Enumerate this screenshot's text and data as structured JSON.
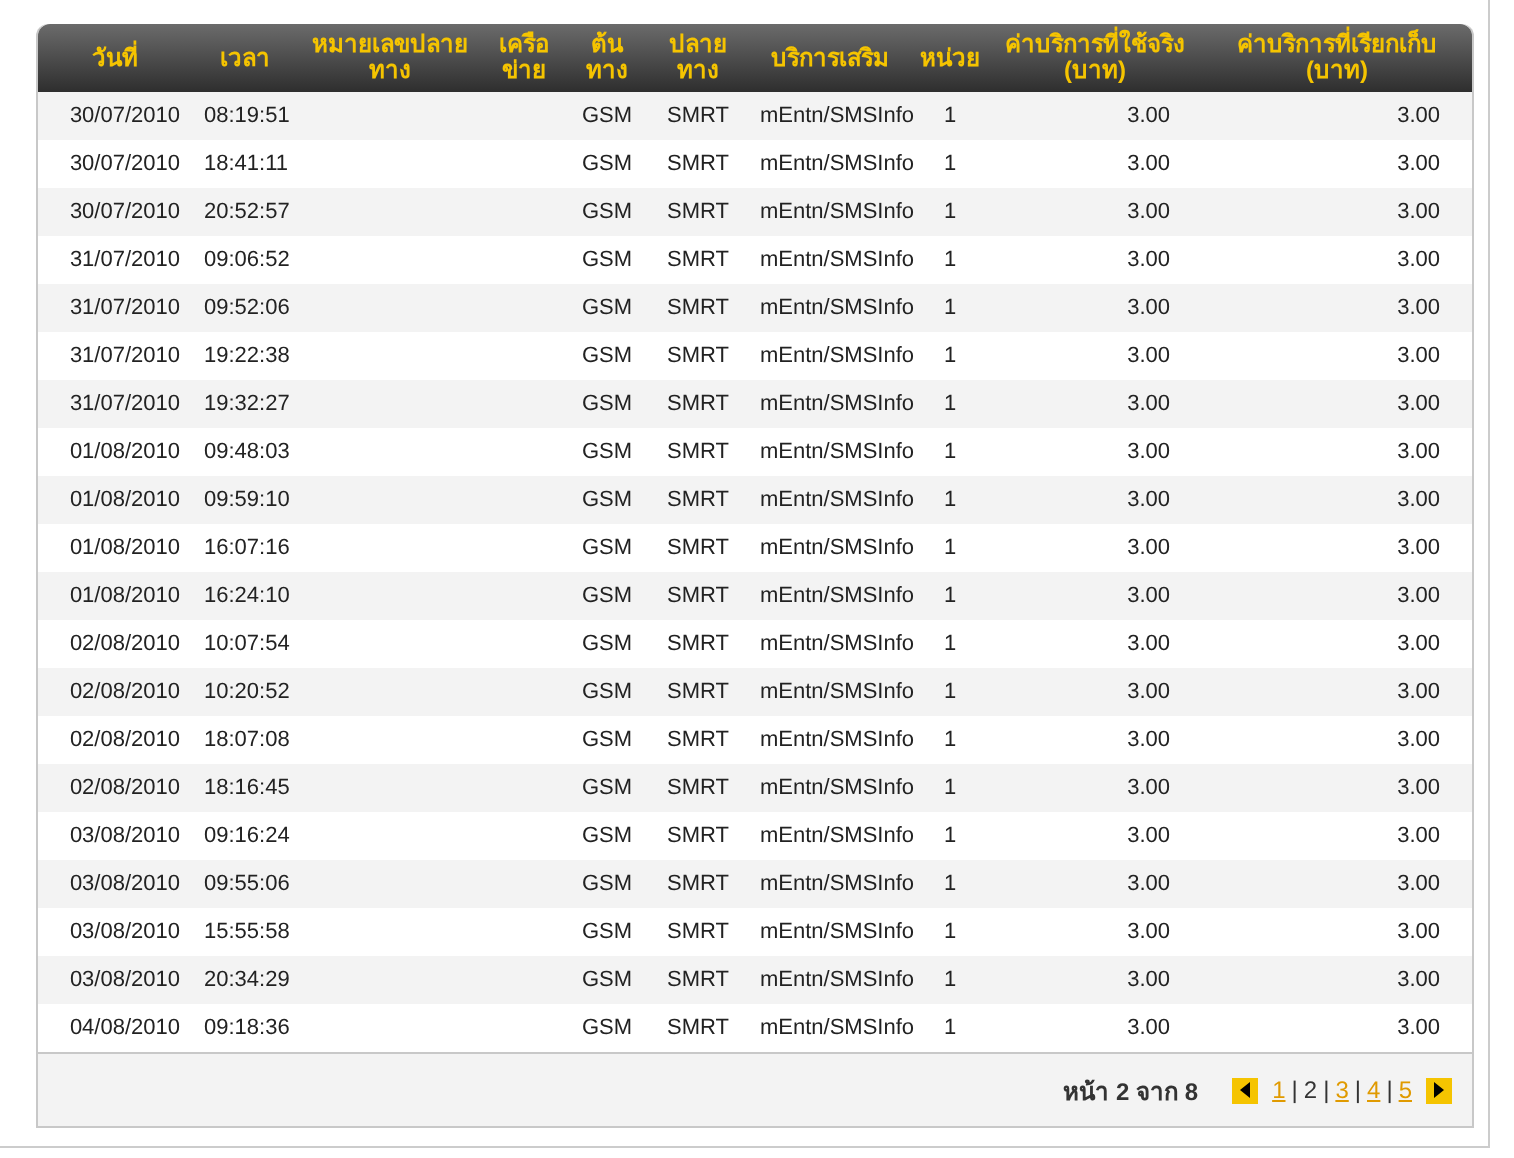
{
  "table": {
    "columns": [
      "วันที่",
      "เวลา",
      "หมายเลขปลาย ทาง",
      "เครือ ข่าย",
      "ต้น ทาง",
      "ปลาย ทาง",
      "บริการเสริม",
      "หน่วย",
      "ค่าบริการที่ใช้จริง (บาท)",
      "ค่าบริการที่เรียกเก็บ (บาท)"
    ],
    "rows": [
      [
        "30/07/2010",
        "08:19:51",
        "",
        "",
        "GSM",
        "SMRT",
        "mEntn/SMSInfo",
        "1",
        "3.00",
        "3.00"
      ],
      [
        "30/07/2010",
        "18:41:11",
        "",
        "",
        "GSM",
        "SMRT",
        "mEntn/SMSInfo",
        "1",
        "3.00",
        "3.00"
      ],
      [
        "30/07/2010",
        "20:52:57",
        "",
        "",
        "GSM",
        "SMRT",
        "mEntn/SMSInfo",
        "1",
        "3.00",
        "3.00"
      ],
      [
        "31/07/2010",
        "09:06:52",
        "",
        "",
        "GSM",
        "SMRT",
        "mEntn/SMSInfo",
        "1",
        "3.00",
        "3.00"
      ],
      [
        "31/07/2010",
        "09:52:06",
        "",
        "",
        "GSM",
        "SMRT",
        "mEntn/SMSInfo",
        "1",
        "3.00",
        "3.00"
      ],
      [
        "31/07/2010",
        "19:22:38",
        "",
        "",
        "GSM",
        "SMRT",
        "mEntn/SMSInfo",
        "1",
        "3.00",
        "3.00"
      ],
      [
        "31/07/2010",
        "19:32:27",
        "",
        "",
        "GSM",
        "SMRT",
        "mEntn/SMSInfo",
        "1",
        "3.00",
        "3.00"
      ],
      [
        "01/08/2010",
        "09:48:03",
        "",
        "",
        "GSM",
        "SMRT",
        "mEntn/SMSInfo",
        "1",
        "3.00",
        "3.00"
      ],
      [
        "01/08/2010",
        "09:59:10",
        "",
        "",
        "GSM",
        "SMRT",
        "mEntn/SMSInfo",
        "1",
        "3.00",
        "3.00"
      ],
      [
        "01/08/2010",
        "16:07:16",
        "",
        "",
        "GSM",
        "SMRT",
        "mEntn/SMSInfo",
        "1",
        "3.00",
        "3.00"
      ],
      [
        "01/08/2010",
        "16:24:10",
        "",
        "",
        "GSM",
        "SMRT",
        "mEntn/SMSInfo",
        "1",
        "3.00",
        "3.00"
      ],
      [
        "02/08/2010",
        "10:07:54",
        "",
        "",
        "GSM",
        "SMRT",
        "mEntn/SMSInfo",
        "1",
        "3.00",
        "3.00"
      ],
      [
        "02/08/2010",
        "10:20:52",
        "",
        "",
        "GSM",
        "SMRT",
        "mEntn/SMSInfo",
        "1",
        "3.00",
        "3.00"
      ],
      [
        "02/08/2010",
        "18:07:08",
        "",
        "",
        "GSM",
        "SMRT",
        "mEntn/SMSInfo",
        "1",
        "3.00",
        "3.00"
      ],
      [
        "02/08/2010",
        "18:16:45",
        "",
        "",
        "GSM",
        "SMRT",
        "mEntn/SMSInfo",
        "1",
        "3.00",
        "3.00"
      ],
      [
        "03/08/2010",
        "09:16:24",
        "",
        "",
        "GSM",
        "SMRT",
        "mEntn/SMSInfo",
        "1",
        "3.00",
        "3.00"
      ],
      [
        "03/08/2010",
        "09:55:06",
        "",
        "",
        "GSM",
        "SMRT",
        "mEntn/SMSInfo",
        "1",
        "3.00",
        "3.00"
      ],
      [
        "03/08/2010",
        "15:55:58",
        "",
        "",
        "GSM",
        "SMRT",
        "mEntn/SMSInfo",
        "1",
        "3.00",
        "3.00"
      ],
      [
        "03/08/2010",
        "20:34:29",
        "",
        "",
        "GSM",
        "SMRT",
        "mEntn/SMSInfo",
        "1",
        "3.00",
        "3.00"
      ],
      [
        "04/08/2010",
        "09:18:36",
        "",
        "",
        "GSM",
        "SMRT",
        "mEntn/SMSInfo",
        "1",
        "3.00",
        "3.00"
      ]
    ]
  },
  "pagination": {
    "label": "หน้า 2 จาก 8",
    "separator": "|",
    "pages": [
      {
        "label": "1",
        "selected": false
      },
      {
        "label": "2",
        "selected": true
      },
      {
        "label": "3",
        "selected": false
      },
      {
        "label": "4",
        "selected": false
      },
      {
        "label": "5",
        "selected": false
      }
    ]
  }
}
